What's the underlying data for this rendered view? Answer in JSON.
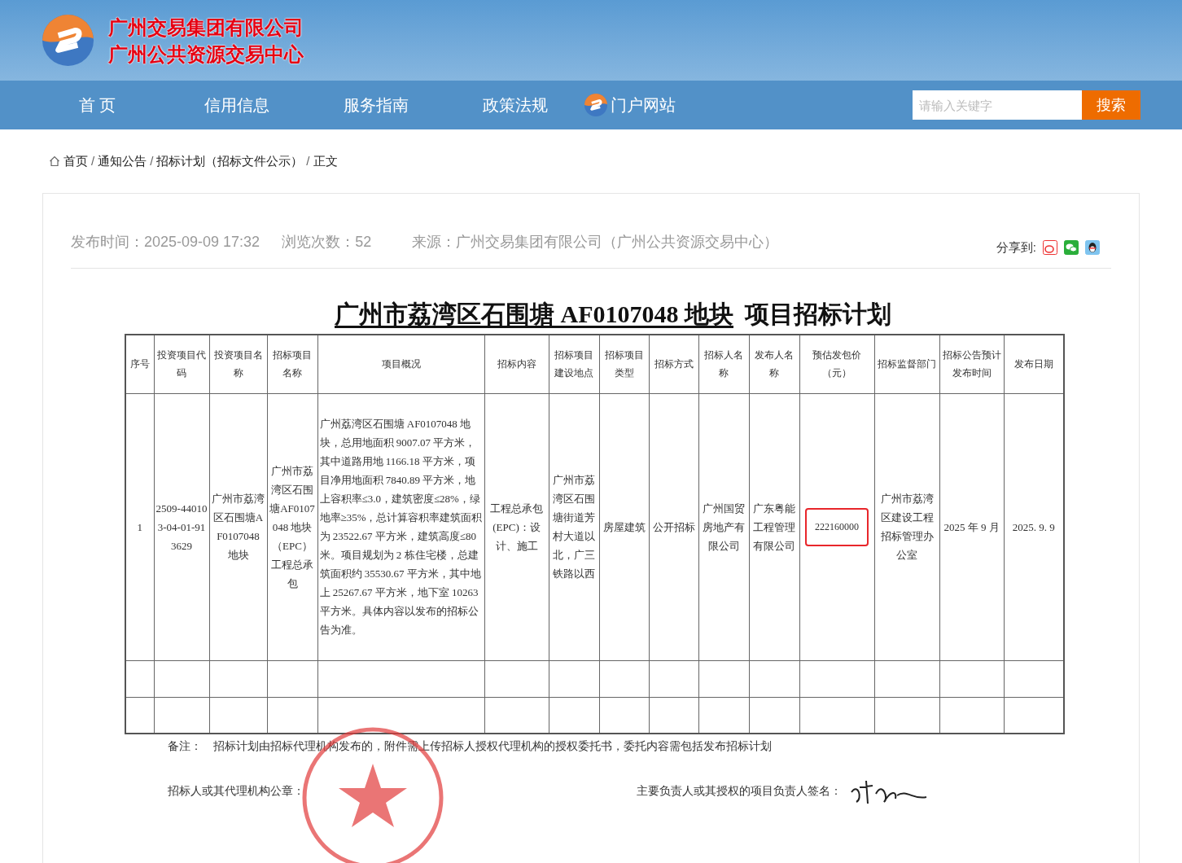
{
  "header": {
    "org_name": "广州交易集团有限公司",
    "center_name": "广州公共资源交易中心"
  },
  "nav": {
    "items": [
      {
        "label": "首 页",
        "kind": "link"
      },
      {
        "label": "信用信息",
        "kind": "link"
      },
      {
        "label": "服务指南",
        "kind": "link"
      },
      {
        "label": "政策法规",
        "kind": "link"
      },
      {
        "label": "门户网站",
        "kind": "portal"
      }
    ],
    "search": {
      "placeholder": "请输入关键字",
      "button": "搜索"
    }
  },
  "breadcrumb": {
    "separator": "/",
    "items": [
      "首页",
      "通知公告",
      "招标计划（招标文件公示）",
      "正文"
    ]
  },
  "article": {
    "published": "发布时间：2025-09-09 17:32",
    "views": "浏览次数：52",
    "source": "来源：广州交易集团有限公司（广州公共资源交易中心）",
    "share_label": "分享到:"
  },
  "document": {
    "title_subject": "广州市荔湾区石围塘 AF0107048 地块",
    "title_suffix": "项目招标计划",
    "table": {
      "columns": [
        "序号",
        "投资项目代码",
        "投资项目名称",
        "招标项目名称",
        "项目概况",
        "招标内容",
        "招标项目建设地点",
        "招标项目类型",
        "招标方式",
        "招标人名称",
        "发布人名称",
        "预估发包价（元）",
        "招标监督部门",
        "招标公告预计发布时间",
        "发布日期"
      ],
      "rows": [
        {
          "kind": "data",
          "cells": [
            {
              "text": "1",
              "highlighted": false
            },
            {
              "text": "2509-440103-04-01-913629",
              "highlighted": false
            },
            {
              "text": "广州市荔湾区石围塘AF0107048 地块",
              "highlighted": false
            },
            {
              "text": "广州市荔湾区石围塘AF0107048 地块（EPC）工程总承包",
              "highlighted": false
            },
            {
              "text": "广州荔湾区石围塘 AF0107048 地块，总用地面积 9007.07 平方米，其中道路用地 1166.18 平方米，项目净用地面积 7840.89 平方米，地上容积率≤3.0，建筑密度≤28%，绿地率≥35%，总计算容积率建筑面积为 23522.67 平方米，建筑高度≤80 米。项目规划为 2 栋住宅楼，总建筑面积约 35530.67 平方米，其中地上 25267.67 平方米，地下室 10263 平方米。具体内容以发布的招标公告为准。",
              "highlighted": false
            },
            {
              "text": "工程总承包(EPC)：设计、施工",
              "highlighted": false
            },
            {
              "text": "广州市荔湾区石围塘街道芳村大道以北，广三铁路以西",
              "highlighted": false
            },
            {
              "text": "房屋建筑",
              "highlighted": false
            },
            {
              "text": "公开招标",
              "highlighted": false
            },
            {
              "text": "广州国贸房地产有限公司",
              "highlighted": false
            },
            {
              "text": "广东粤能工程管理有限公司",
              "highlighted": false
            },
            {
              "text": "222160000",
              "highlighted": true
            },
            {
              "text": "广州市荔湾区建设工程招标管理办公室",
              "highlighted": false
            },
            {
              "text": "2025 年 9 月",
              "highlighted": false
            },
            {
              "text": "2025. 9. 9",
              "highlighted": false
            }
          ]
        },
        {
          "kind": "blank"
        },
        {
          "kind": "blank"
        }
      ]
    },
    "note_label": "备注：",
    "note": "招标计划由招标代理机构发布的，附件需上传招标人授权代理机构的授权委托书，委托内容需包括发布招标计划",
    "seal_label": "招标人或其代理机构公章：",
    "signature_label": "主要负责人或其授权的项目负责人签名："
  }
}
